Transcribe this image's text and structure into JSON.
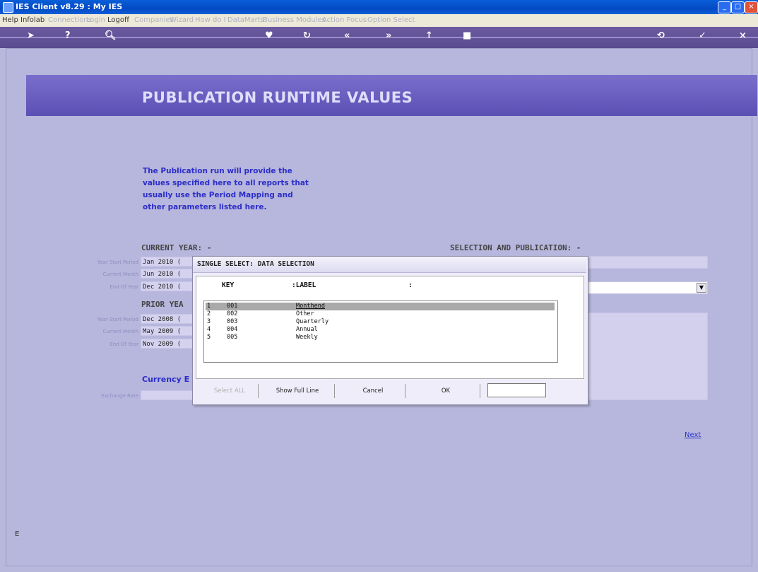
{
  "window": {
    "title": "IES Client v8.29 : My IES",
    "min_label": "_",
    "max_label": "□",
    "close_label": "×"
  },
  "menu": [
    {
      "label": "Help",
      "enabled": true
    },
    {
      "label": "Infolab",
      "enabled": true
    },
    {
      "label": "Connections",
      "enabled": false
    },
    {
      "label": "Login",
      "enabled": false
    },
    {
      "label": "Logoff",
      "enabled": true
    },
    {
      "label": "Companies",
      "enabled": false
    },
    {
      "label": "Wizard",
      "enabled": false
    },
    {
      "label": "How do I",
      "enabled": false
    },
    {
      "label": "DataMarts",
      "enabled": false
    },
    {
      "label": "Business Modules",
      "enabled": false
    },
    {
      "label": "Action Focus",
      "enabled": false
    },
    {
      "label": "Option Select",
      "enabled": false
    }
  ],
  "page": {
    "title": "PUBLICATION RUNTIME VALUES",
    "intro": [
      "The Publication run will provide the",
      "values specified here to all reports that",
      "usually use the Period Mapping and",
      "other parameters listed here."
    ],
    "current_year": {
      "heading": "CURRENT YEAR: -",
      "labels": [
        "Year Start Period",
        "Current Month",
        "End Of Year"
      ],
      "values": [
        "Jan 2010 (",
        "Jun 2010 (",
        "Dec 2010 ("
      ]
    },
    "prior_year": {
      "heading": "PRIOR YEA",
      "labels": [
        "Year Start Period",
        "Current Month",
        "End Of Year"
      ],
      "values": [
        "Dec 2008 (",
        "May 2009 (",
        "Nov 2009 ("
      ]
    },
    "currency": {
      "heading": "Currency E",
      "label": "Exchange Rate"
    },
    "selection_heading": "SELECTION AND PUBLICATION: -",
    "next_link": "Next",
    "side_label": "E"
  },
  "dialog": {
    "title": "SINGLE SELECT: DATA SELECTION",
    "col_key": "KEY",
    "col_label": ":LABEL",
    "col_extra": ":",
    "rows": [
      {
        "num": "1",
        "key": "001",
        "label": "Monthend",
        "selected": true
      },
      {
        "num": "2",
        "key": "002",
        "label": "Other",
        "selected": false
      },
      {
        "num": "3",
        "key": "003",
        "label": "Quarterly",
        "selected": false
      },
      {
        "num": "4",
        "key": "004",
        "label": "Annual",
        "selected": false
      },
      {
        "num": "5",
        "key": "005",
        "label": "Weekly",
        "selected": false
      }
    ],
    "buttons": {
      "select_all": "Select ALL",
      "show_full_line": "Show Full Line",
      "cancel": "Cancel",
      "ok": "OK"
    },
    "ok_value": ""
  }
}
